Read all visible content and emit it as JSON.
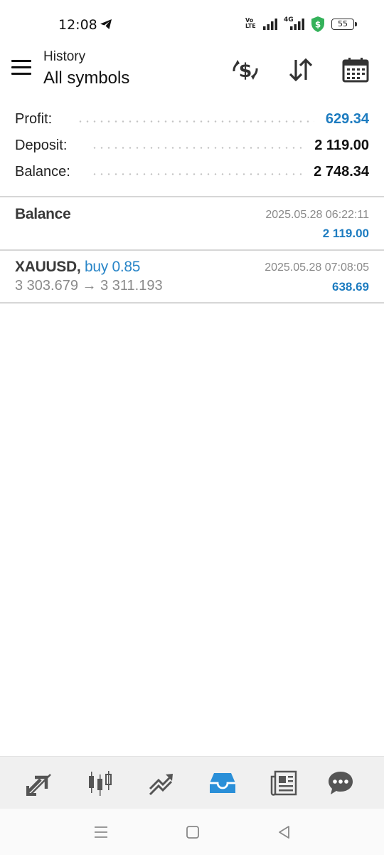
{
  "status_bar": {
    "time": "12:08",
    "volte_top": "Vo",
    "volte_bottom": "LTE",
    "network_label": "4G",
    "battery": "55",
    "shield_color": "#34b25a"
  },
  "header": {
    "subtitle": "History",
    "title": "All symbols",
    "icons": [
      "menu-icon",
      "currency-exchange-icon",
      "sort-icon",
      "calendar-icon"
    ]
  },
  "summary": {
    "profit_label": "Profit:",
    "profit_value": "629.34",
    "deposit_label": "Deposit:",
    "deposit_value": "2 119.00",
    "balance_label": "Balance:",
    "balance_value": "2 748.34"
  },
  "deals": [
    {
      "title": "Balance",
      "time": "2025.05.28 06:22:11",
      "amount": "2 119.00"
    },
    {
      "symbol": "XAUUSD,",
      "side": "buy 0.85",
      "time": "2025.05.28 07:08:05",
      "prices": "3 303.679 → 3 311.193",
      "amount": "638.69"
    }
  ],
  "bottom_nav": {
    "items": [
      "quotes-icon",
      "chart-icon",
      "trade-icon",
      "history-icon",
      "news-icon",
      "chat-icon"
    ],
    "active": "history-icon"
  },
  "colors": {
    "accent": "#1d7cc0",
    "nav_icon": "#555555",
    "nav_active": "#2a8fd8"
  }
}
